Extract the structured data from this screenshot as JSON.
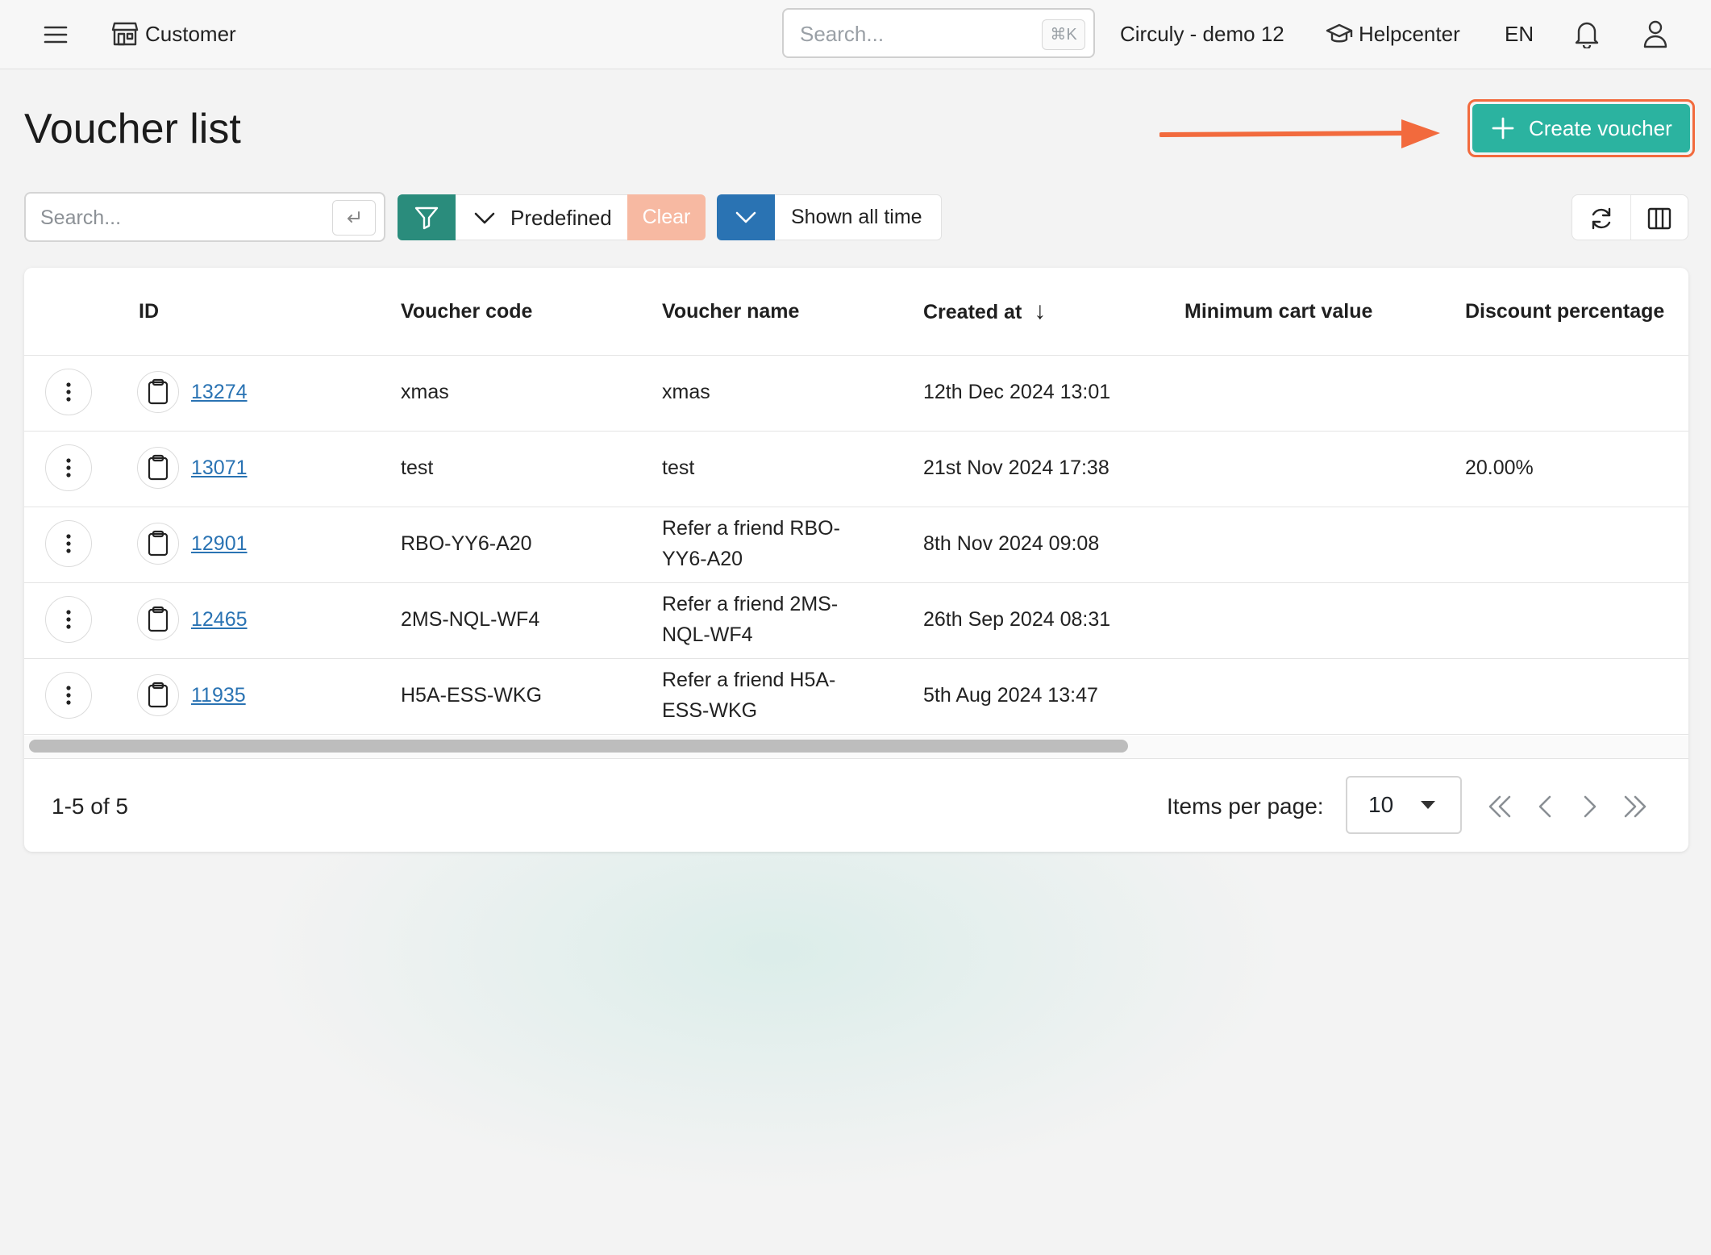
{
  "topbar": {
    "app_name": "Customer",
    "search_placeholder": "Search...",
    "search_shortcut": "⌘K",
    "account_name": "Circuly - demo 12",
    "helpcenter_label": "Helpcenter",
    "language": "EN"
  },
  "page": {
    "title": "Voucher list",
    "create_button_label": "Create voucher",
    "annotation_color": "#f26a3d",
    "accent_color": "#2bb3a0"
  },
  "filters": {
    "search_placeholder": "Search...",
    "predefined_label": "Predefined",
    "clear_label": "Clear",
    "time_range_label": "Shown all time"
  },
  "table": {
    "columns": {
      "id": "ID",
      "code": "Voucher code",
      "name": "Voucher name",
      "created": "Created at",
      "min_cart": "Minimum cart value",
      "discount": "Discount percentage"
    },
    "sort_indicator": "↓",
    "rows": [
      {
        "id": "13274",
        "code": "xmas",
        "name_l1": "xmas",
        "name_l2": "",
        "created": "12th Dec 2024 13:01",
        "min_cart": "",
        "discount": ""
      },
      {
        "id": "13071",
        "code": "test",
        "name_l1": "test",
        "name_l2": "",
        "created": "21st Nov 2024 17:38",
        "min_cart": "",
        "discount": "20.00%"
      },
      {
        "id": "12901",
        "code": "RBO-YY6-A20",
        "name_l1": "Refer a friend RBO-",
        "name_l2": "YY6-A20",
        "created": "8th Nov 2024 09:08",
        "min_cart": "",
        "discount": ""
      },
      {
        "id": "12465",
        "code": "2MS-NQL-WF4",
        "name_l1": "Refer a friend 2MS-",
        "name_l2": "NQL-WF4",
        "created": "26th Sep 2024 08:31",
        "min_cart": "",
        "discount": ""
      },
      {
        "id": "11935",
        "code": "H5A-ESS-WKG",
        "name_l1": "Refer a friend H5A-",
        "name_l2": "ESS-WKG",
        "created": "5th Aug 2024 13:47",
        "min_cart": "",
        "discount": ""
      }
    ]
  },
  "pagination": {
    "range_label": "1-5 of 5",
    "items_per_page_label": "Items per page:",
    "items_per_page": "10"
  },
  "icons": [
    "menu-icon",
    "store-icon",
    "graduation-cap-icon",
    "bell-icon",
    "user-icon",
    "plus-icon",
    "enter-key-icon",
    "filter-icon",
    "chevron-down-icon",
    "refresh-icon",
    "columns-icon",
    "kebab-icon",
    "clipboard-icon",
    "first-page-icon",
    "prev-page-icon",
    "next-page-icon",
    "last-page-icon"
  ]
}
